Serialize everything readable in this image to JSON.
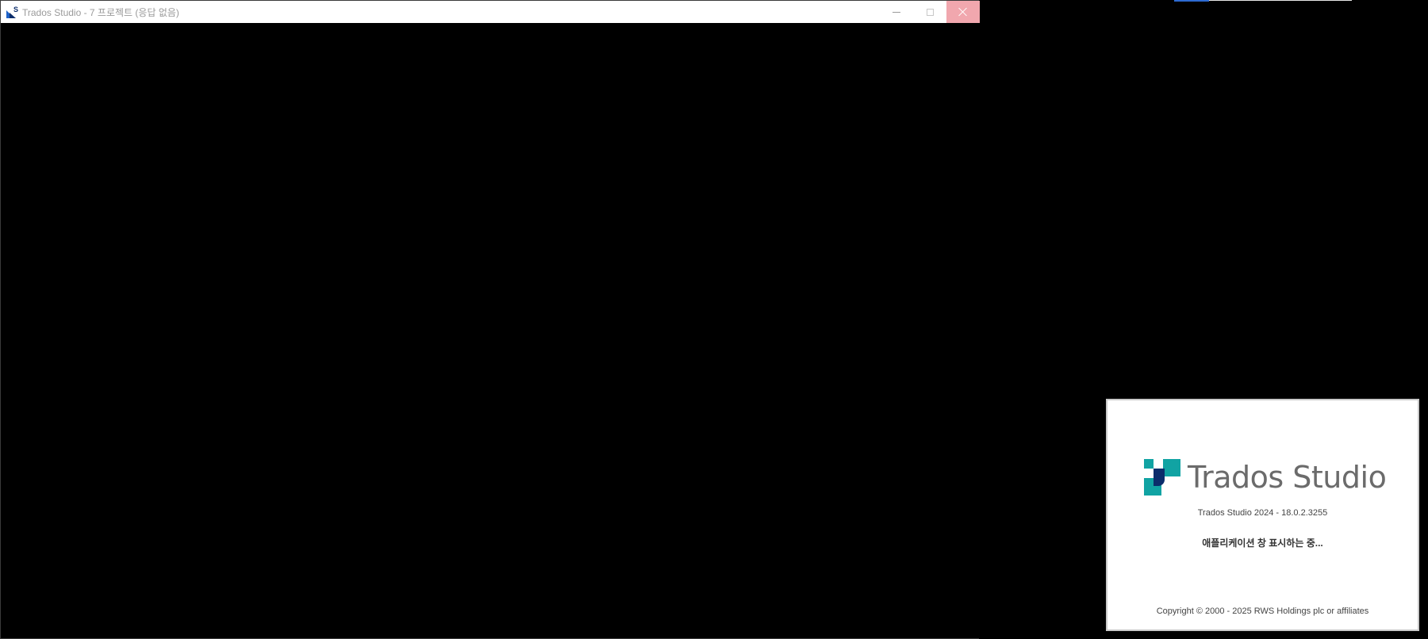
{
  "main_window": {
    "title": "Trados Studio - 7 프로젝트 (응답 없음)",
    "icon": "trados-studio-app-icon",
    "controls": {
      "minimize_icon": "minimize-icon",
      "maximize_icon": "maximize-icon",
      "close_icon": "close-icon",
      "close_hover_color": "#f1a7ae"
    },
    "body_color": "#000000"
  },
  "splash": {
    "logo_text": "Trados Studio",
    "version": "Trados Studio 2024 - 18.0.2.3255",
    "status": "애플리케이션 창 표시하는 중...",
    "copyright": "Copyright © 2000 - 2025 RWS Holdings plc or affiliates",
    "logo_colors": {
      "teal": "#11a3a3",
      "navy": "#0b2d6b"
    }
  }
}
